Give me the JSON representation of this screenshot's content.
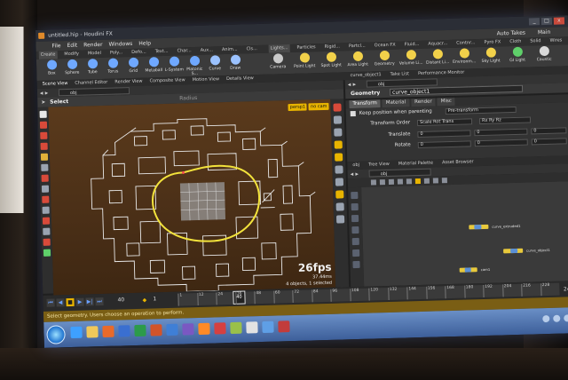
{
  "window": {
    "title": "untitled.hip - Houdini FX",
    "controls": [
      "_",
      "□",
      "x"
    ]
  },
  "menubar": {
    "items": [
      "File",
      "Edit",
      "Render",
      "Windows",
      "Help"
    ],
    "right": [
      "Auto Takes",
      "Main"
    ]
  },
  "shelf_tabs_left": [
    "Create",
    "Modify",
    "Model",
    "Poly...",
    "Defo...",
    "Text...",
    "Char...",
    "Aux...",
    "Anim...",
    "Cls..."
  ],
  "shelf_tabs_right": [
    "Lights...",
    "Particles",
    "Rigid...",
    "Partcl...",
    "Ocean FX",
    "Fluid...",
    "Aquacr...",
    "Contnr...",
    "Pyro FX",
    "Cloth",
    "Solid",
    "Wires"
  ],
  "shelf_tools_left": [
    {
      "label": "Box",
      "icon": "box-icon",
      "color": "#6fa8ff"
    },
    {
      "label": "Sphere",
      "icon": "sphere-icon",
      "color": "#6fa8ff"
    },
    {
      "label": "Tube",
      "icon": "tube-icon",
      "color": "#6fa8ff"
    },
    {
      "label": "Torus",
      "icon": "torus-icon",
      "color": "#6fa8ff"
    },
    {
      "label": "Grid",
      "icon": "grid-icon",
      "color": "#6fa8ff"
    },
    {
      "label": "Metaball",
      "icon": "metaball-icon",
      "color": "#6fa8ff"
    },
    {
      "label": "L-System",
      "icon": "lsystem-icon",
      "color": "#6fa8ff"
    },
    {
      "label": "Platonic S...",
      "icon": "platonic-icon",
      "color": "#6fa8ff"
    },
    {
      "label": "Curve",
      "icon": "curve-icon",
      "color": "#9bc2ff"
    },
    {
      "label": "Draw",
      "icon": "draw-icon",
      "color": "#9bc2ff"
    }
  ],
  "shelf_tools_right": [
    {
      "label": "Camera",
      "icon": "camera-icon",
      "color": "#c9c9c9"
    },
    {
      "label": "Point Light",
      "icon": "point-light-icon",
      "color": "#f2d14a"
    },
    {
      "label": "Spot Light",
      "icon": "spot-light-icon",
      "color": "#f2d14a"
    },
    {
      "label": "Area Light",
      "icon": "area-light-icon",
      "color": "#f2d14a"
    },
    {
      "label": "Geometry",
      "icon": "geometry-light-icon",
      "color": "#f2d14a"
    },
    {
      "label": "Volume Li...",
      "icon": "volume-light-icon",
      "color": "#f2d14a"
    },
    {
      "label": "Distant Li...",
      "icon": "distant-light-icon",
      "color": "#f2d14a"
    },
    {
      "label": "Environm...",
      "icon": "environment-light-icon",
      "color": "#f2d14a"
    },
    {
      "label": "Sky Light",
      "icon": "sky-light-icon",
      "color": "#f2d14a"
    },
    {
      "label": "GI Light",
      "icon": "gi-light-icon",
      "color": "#5fd06a"
    },
    {
      "label": "Caustic",
      "icon": "caustic-light-icon",
      "color": "#d9d9d9"
    }
  ],
  "left_panel_tabs": [
    "Scene View",
    "Channel Editor",
    "Render View",
    "Composite View",
    "Motion View",
    "Details View"
  ],
  "viewport": {
    "path": "obj",
    "tool": "Select",
    "radius_label": "Radius",
    "camera_menu": "persp1",
    "cam_menu": "no cam",
    "fps": "26fps",
    "ms": "37.44ms",
    "selection_info": "4 objects, 1 selected"
  },
  "right_panel_tabs": [
    "curve_object1",
    "Take List",
    "Performance Monitor"
  ],
  "parameters": {
    "path": "obj",
    "type_label": "Geometry",
    "node_name": "curve_object1",
    "tabs": [
      "Transform",
      "Material",
      "Render",
      "Misc"
    ],
    "keep_position_label": "Keep position when parenting",
    "keep_position_value": "Pre-transform",
    "transform_order_label": "Transform Order",
    "transform_order_value": "Scale Rot Trans",
    "rotate_order_value": "Rx Ry Rz",
    "translate_label": "Translate",
    "translate_values": [
      "0",
      "0",
      "0"
    ],
    "rotate_label": "Rotate",
    "rotate_values": [
      "0",
      "0",
      "0"
    ]
  },
  "network": {
    "tabs": [
      "obj",
      "Tree View",
      "Material Palette",
      "Asset Browser"
    ],
    "path": "obj",
    "nodes": [
      {
        "label": "curve_extruded1",
        "color": "#e8c93c"
      },
      {
        "label": "curve_object1",
        "color": "#e8c93c"
      },
      {
        "label": "cam1",
        "color": "#e8c93c"
      }
    ]
  },
  "timeline": {
    "current_frame": "1",
    "start_field": "40",
    "marker": "40",
    "ticks": [
      "1",
      "12",
      "24",
      "36",
      "48",
      "60",
      "72",
      "84",
      "96",
      "108",
      "120",
      "132",
      "144",
      "156",
      "168",
      "180",
      "192",
      "204",
      "216",
      "228"
    ],
    "end_frame": "240"
  },
  "status": {
    "text": "Select geometry. Users choose an operation to perform."
  },
  "taskbar": {
    "icons": [
      {
        "name": "ie-icon",
        "color": "#3ea0ff"
      },
      {
        "name": "folder-icon",
        "color": "#f0c85a"
      },
      {
        "name": "media-icon",
        "color": "#e86a2a"
      },
      {
        "name": "word-icon",
        "color": "#3a6fd0"
      },
      {
        "name": "excel-icon",
        "color": "#2c9b4a"
      },
      {
        "name": "powerpoint-icon",
        "color": "#d2542a"
      },
      {
        "name": "outlook-icon",
        "color": "#3f7fd6"
      },
      {
        "name": "app-icon",
        "color": "#7a58c2"
      },
      {
        "name": "houdini-icon",
        "color": "#ff8a26"
      },
      {
        "name": "app2-icon",
        "color": "#d64040"
      },
      {
        "name": "app3-icon",
        "color": "#9ac04a"
      },
      {
        "name": "app4-icon",
        "color": "#e2e2e2"
      },
      {
        "name": "app5-icon",
        "color": "#5f9fe6"
      },
      {
        "name": "app6-icon",
        "color": "#c23c3c"
      }
    ]
  }
}
